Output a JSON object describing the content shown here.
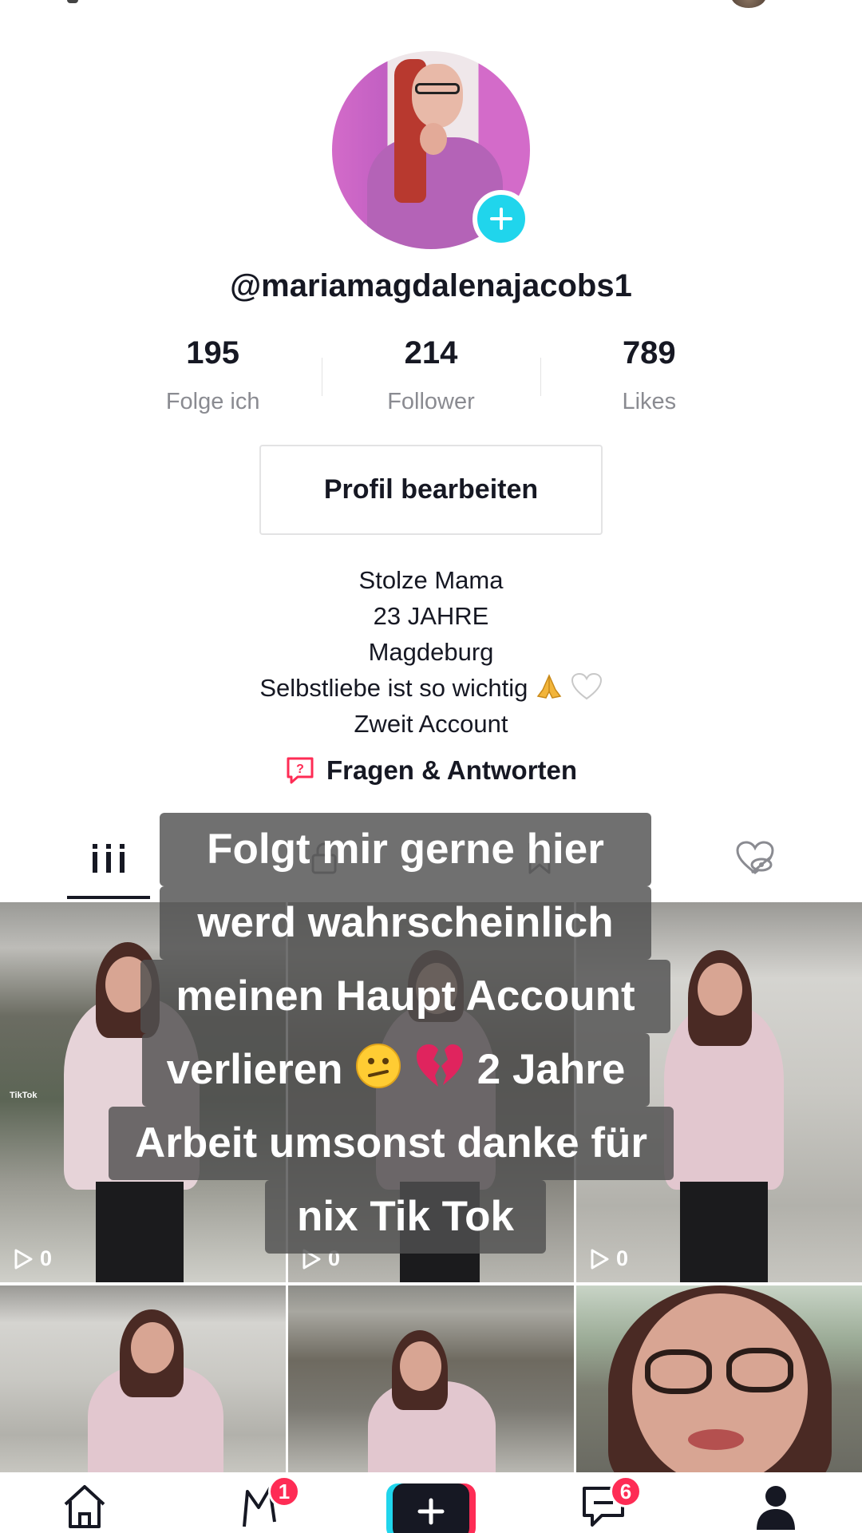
{
  "profile": {
    "username": "@mariamagdalenajacobs1",
    "stats": [
      {
        "value": "195",
        "label": "Folge ich"
      },
      {
        "value": "214",
        "label": "Follower"
      },
      {
        "value": "789",
        "label": "Likes"
      }
    ],
    "edit_button": "Profil bearbeiten",
    "bio": [
      "Stolze Mama",
      "23 JAHRE",
      "Magdeburg",
      "Selbstliebe ist so wichtig",
      "Zweit Account"
    ],
    "qa_label": "Fragen & Antworten"
  },
  "tabs": [
    "videos-grid-icon",
    "lock-icon",
    "bookmark-icon",
    "liked-hidden-icon"
  ],
  "videos": [
    {
      "views": "0"
    },
    {
      "views": "0"
    },
    {
      "views": "0"
    },
    {
      "views": ""
    },
    {
      "views": ""
    },
    {
      "views": ""
    }
  ],
  "caption_overlay": {
    "lines": [
      "Folgt mir gerne hier",
      "werd wahrscheinlich",
      "meinen Haupt Account",
      "verlieren",
      "2 Jahre",
      "Arbeit umsonst danke für",
      "nix Tik Tok"
    ],
    "emojis": [
      "confused-face-emoji",
      "broken-heart-emoji"
    ]
  },
  "navbar": {
    "items": [
      "home-icon",
      "discover-icon",
      "create-icon",
      "inbox-icon",
      "profile-icon"
    ],
    "badges": {
      "discover": "1",
      "inbox": "6"
    }
  },
  "colors": {
    "accent_cyan": "#20d5ec",
    "accent_red": "#fe2c55",
    "text_primary": "#161823",
    "text_secondary": "#8a8b91"
  }
}
